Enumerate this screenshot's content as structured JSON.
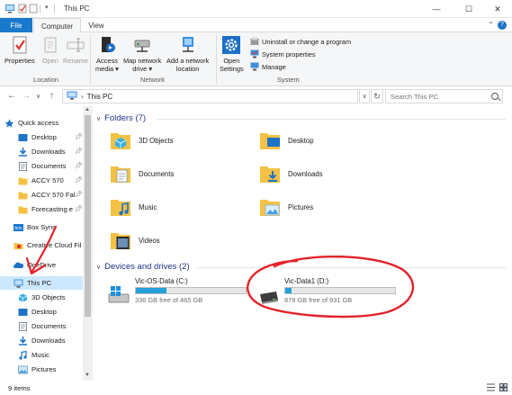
{
  "window": {
    "title": "This PC",
    "minimize": "—",
    "maximize": "☐",
    "close": "✕"
  },
  "ribbon_tabs": {
    "file": "File",
    "computer": "Computer",
    "view": "View"
  },
  "ribbon": {
    "location": {
      "label": "Location",
      "properties": "Properties",
      "open": "Open",
      "rename": "Rename"
    },
    "network": {
      "label": "Network",
      "access_media_1": "Access",
      "access_media_2": "media ▾",
      "map_drive_1": "Map network",
      "map_drive_2": "drive ▾",
      "add_location_1": "Add a network",
      "add_location_2": "location"
    },
    "system": {
      "label": "System",
      "open_settings_1": "Open",
      "open_settings_2": "Settings",
      "uninstall": "Uninstall or change a program",
      "system_properties": "System properties",
      "manage": "Manage"
    }
  },
  "address": {
    "path": "This PC",
    "search_placeholder": "Search This PC"
  },
  "nav": {
    "items": [
      {
        "label": "Quick access",
        "icon": "star-icon"
      },
      {
        "label": "Desktop",
        "icon": "desktop-icon",
        "pinned": true
      },
      {
        "label": "Downloads",
        "icon": "download-icon",
        "pinned": true
      },
      {
        "label": "Documents",
        "icon": "documents-icon",
        "pinned": true
      },
      {
        "label": "ACCY 570",
        "icon": "folder-icon",
        "pinned": true
      },
      {
        "label": "ACCY 570 Fal",
        "icon": "folder-icon",
        "pinned": true
      },
      {
        "label": "Forecasting e",
        "icon": "folder-icon",
        "pinned": true
      },
      {
        "label": "Box Sync",
        "icon": "box-icon"
      },
      {
        "label": "Creative Cloud Fil",
        "icon": "creative-cloud-icon"
      },
      {
        "label": "OneDrive",
        "icon": "cloud-icon"
      },
      {
        "label": "This PC",
        "icon": "computer-icon",
        "selected": true
      },
      {
        "label": "3D Objects",
        "icon": "3d-objects-icon"
      },
      {
        "label": "Desktop",
        "icon": "desktop-icon"
      },
      {
        "label": "Documents",
        "icon": "documents-icon"
      },
      {
        "label": "Downloads",
        "icon": "download-icon"
      },
      {
        "label": "Music",
        "icon": "music-icon"
      },
      {
        "label": "Pictures",
        "icon": "pictures-icon"
      }
    ]
  },
  "folders": {
    "heading": "Folders (7)",
    "items": [
      {
        "label": "3D Objects",
        "icon": "3d-objects-folder-icon"
      },
      {
        "label": "Desktop",
        "icon": "desktop-folder-icon"
      },
      {
        "label": "Documents",
        "icon": "documents-folder-icon"
      },
      {
        "label": "Downloads",
        "icon": "downloads-folder-icon"
      },
      {
        "label": "Music",
        "icon": "music-folder-icon"
      },
      {
        "label": "Pictures",
        "icon": "pictures-folder-icon"
      },
      {
        "label": "Videos",
        "icon": "videos-folder-icon"
      }
    ]
  },
  "drives": {
    "heading": "Devices and drives (2)",
    "items": [
      {
        "name": "Vic-OS-Data (C:)",
        "free": "336 GB free of 465 GB",
        "used_fraction": 0.28
      },
      {
        "name": "Vic-Data1 (D:)",
        "free": "879 GB free of 931 GB",
        "used_fraction": 0.06
      }
    ]
  },
  "status": {
    "count": "9 items"
  },
  "colors": {
    "accent": "#1979ca",
    "selection": "#cce8ff",
    "drive_bar": "#26a0da",
    "folder": "#f4c144",
    "annotation": "#e4222a"
  }
}
